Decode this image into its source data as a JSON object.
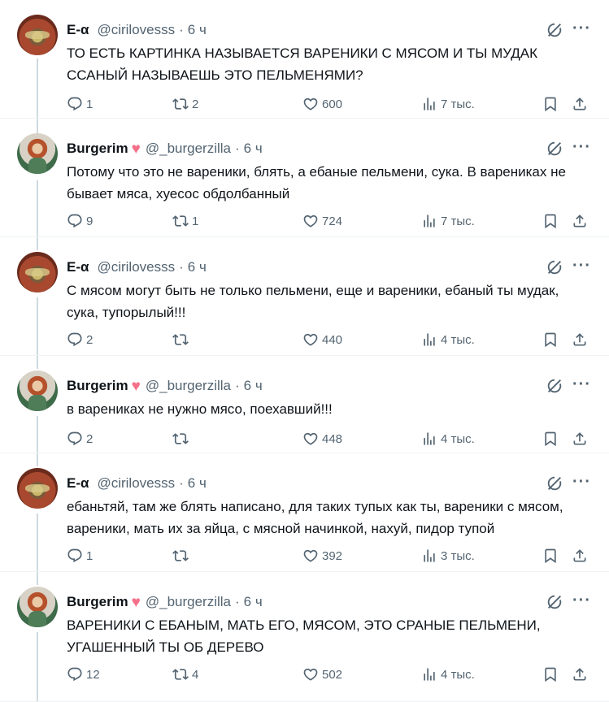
{
  "tweets": [
    {
      "name": "E-α",
      "heart": "",
      "handle": "@cirilovesss",
      "time": "6 ч",
      "text": "ТО ЕСТЬ КАРТИНКА НАЗЫВАЕТСЯ ВАРЕНИКИ С МЯСОМ И ТЫ МУДАК ССАНЫЙ НАЗЫВАЕШЬ ЭТО ПЕЛЬМЕНЯМИ?",
      "replies": "1",
      "retweets": "2",
      "likes": "600",
      "views": "7 тыс."
    },
    {
      "name": "Burgerim",
      "heart": "♥",
      "handle": "@_burgerzilla",
      "time": "6 ч",
      "text": "Потому что это не вареники, блять, а ебаные пельмени, сука. В варениках не бывает мяса, хуесос обдолбанный",
      "replies": "9",
      "retweets": "1",
      "likes": "724",
      "views": "7 тыс."
    },
    {
      "name": "E-α",
      "heart": "",
      "handle": "@cirilovesss",
      "time": "6 ч",
      "text": "С мясом могут быть не только пельмени, еще и вареники, ебаный ты мудак, сука, тупорылый!!!",
      "replies": "2",
      "retweets": "",
      "likes": "440",
      "views": "4 тыс."
    },
    {
      "name": "Burgerim",
      "heart": "♥",
      "handle": "@_burgerzilla",
      "time": "6 ч",
      "text": "в варениках не нужно мясо, поехавший!!!",
      "replies": "2",
      "retweets": "",
      "likes": "448",
      "views": "4 тыс."
    },
    {
      "name": "E-α",
      "heart": "",
      "handle": "@cirilovesss",
      "time": "6 ч",
      "text": "ебаньтяй, там же блять написано, для таких тупых как ты, вареники с мясом, вареники, мать их за яйца, с мясной начинкой, нахуй, пидор тупой",
      "replies": "1",
      "retweets": "",
      "likes": "392",
      "views": "3 тыс."
    },
    {
      "name": "Burgerim",
      "heart": "♥",
      "handle": "@_burgerzilla",
      "time": "6 ч",
      "text": "ВАРЕНИКИ С ЕБАНЫМ, МАТЬ ЕГО, МЯСОМ, ЭТО СРАНЫЕ ПЕЛЬМЕНИ, УГАШЕННЫЙ ТЫ ОБ ДЕРЕВО",
      "replies": "12",
      "retweets": "4",
      "likes": "502",
      "views": "4 тыс."
    }
  ],
  "icons": {
    "reply": "reply-icon",
    "retweet": "retweet-icon",
    "like": "heart-icon",
    "views": "views-icon",
    "bookmark": "bookmark-icon",
    "share": "share-icon",
    "grok": "grok-icon",
    "more": "more-icon"
  },
  "colors": {
    "text": "#0f1419",
    "muted": "#536471",
    "heart": "#f4708a",
    "thread_line": "#cfd9de"
  }
}
